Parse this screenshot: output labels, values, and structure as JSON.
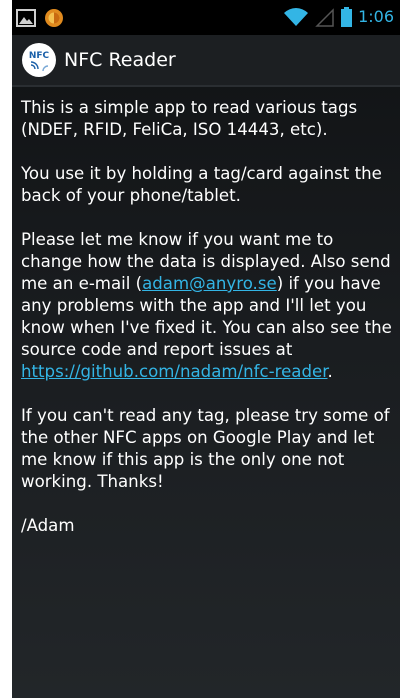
{
  "status_bar": {
    "time": "1:06",
    "left_icons": [
      "image-notification-icon",
      "firefox-icon"
    ],
    "right_icons": [
      "wifi-icon",
      "signal-icon",
      "battery-icon"
    ]
  },
  "action_bar": {
    "logo_text": "NFC",
    "title": "NFC Reader"
  },
  "content": {
    "p1": "This is a simple app to read various tags (NDEF, RFID, FeliCa, ISO 14443, etc).",
    "p2": "You use it by holding a tag/card against the back of your phone/tablet.",
    "p3_part1": "Please let me know if you want me to change how the data is displayed. Also send me an e-mail (",
    "p3_email": "adam@anyro.se",
    "p3_part2": ") if you have any problems with the app and I'll let you know when I've fixed it. You can also see the source code and report issues at ",
    "p3_url": "https://github.com/nadam/nfc-reader",
    "p3_part3": ".",
    "p4": "If you can't read any tag, please try some of the other NFC apps on Google Play and let me know if this app is the only one not working. Thanks!",
    "signature": "/Adam"
  },
  "colors": {
    "accent": "#33b5e5",
    "status_bar": "#000000",
    "background": "#1a1d20"
  }
}
